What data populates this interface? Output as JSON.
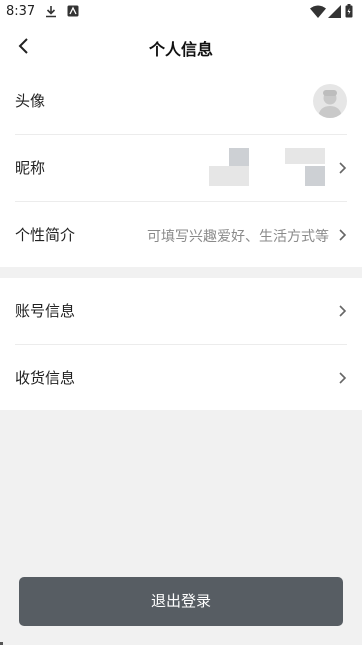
{
  "status_bar": {
    "time": "8:37"
  },
  "header": {
    "title": "个人信息"
  },
  "profile": {
    "avatar_label": "头像",
    "nickname_label": "昵称",
    "bio_label": "个性简介",
    "bio_placeholder": "可填写兴趣爱好、生活方式等"
  },
  "account": {
    "account_info_label": "账号信息",
    "shipping_info_label": "收货信息"
  },
  "footer": {
    "logout_label": "退出登录"
  },
  "colors": {
    "button_bg": "#575d63",
    "page_bg": "#f1f1f1"
  }
}
